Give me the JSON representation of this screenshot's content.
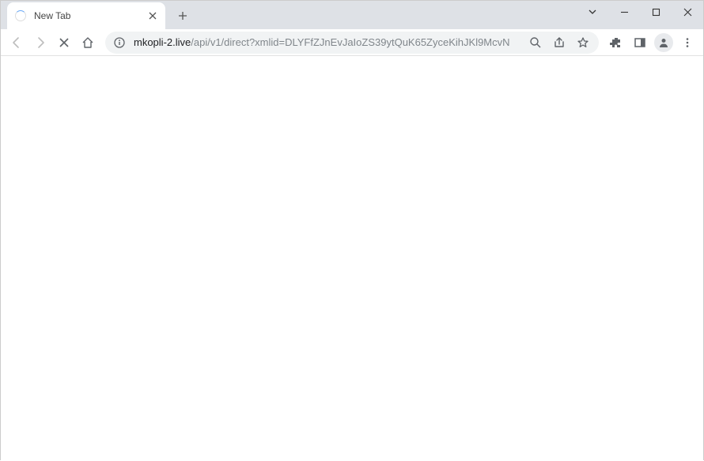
{
  "tab": {
    "title": "New Tab",
    "loading": true
  },
  "address": {
    "host": "mkopli-2.live",
    "path": "/api/v1/direct?xmlid=DLYFfZJnEvJaIoZS39ytQuK65ZyceKihJKl9McvN"
  }
}
